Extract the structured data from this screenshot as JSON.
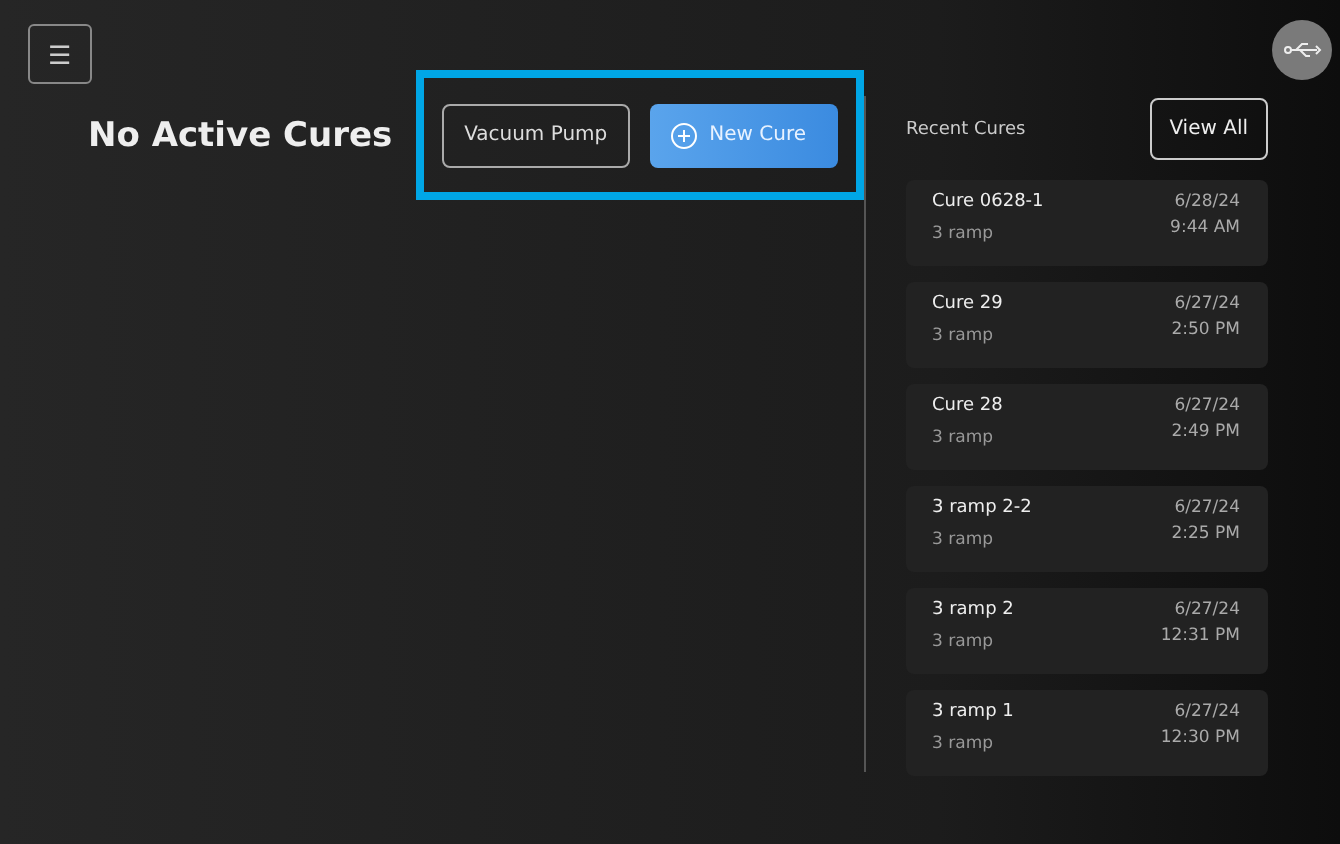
{
  "menu_button": {
    "label": "☰"
  },
  "title": "No Active Cures",
  "actions": [
    {
      "label": "Vacuum Pump",
      "kind": "outline"
    },
    {
      "label": "New Cure",
      "kind": "primary"
    }
  ],
  "recent": {
    "heading": "Recent Cures",
    "view_all": "View All",
    "items": [
      {
        "name": "Cure 0628-1",
        "recipe": "3 ramp",
        "date": "6/28/24",
        "time": "9:44 AM"
      },
      {
        "name": "Cure 29",
        "recipe": "3 ramp",
        "date": "6/27/24",
        "time": "2:50 PM"
      },
      {
        "name": "Cure 28",
        "recipe": "3 ramp",
        "date": "6/27/24",
        "time": "2:49 PM"
      },
      {
        "name": "3 ramp 2-2",
        "recipe": "3 ramp",
        "date": "6/27/24",
        "time": "2:25 PM"
      },
      {
        "name": "3 ramp 2",
        "recipe": "3 ramp",
        "date": "6/27/24",
        "time": "12:31 PM"
      },
      {
        "name": "3 ramp 1",
        "recipe": "3 ramp",
        "date": "6/27/24",
        "time": "12:30 PM"
      }
    ]
  }
}
